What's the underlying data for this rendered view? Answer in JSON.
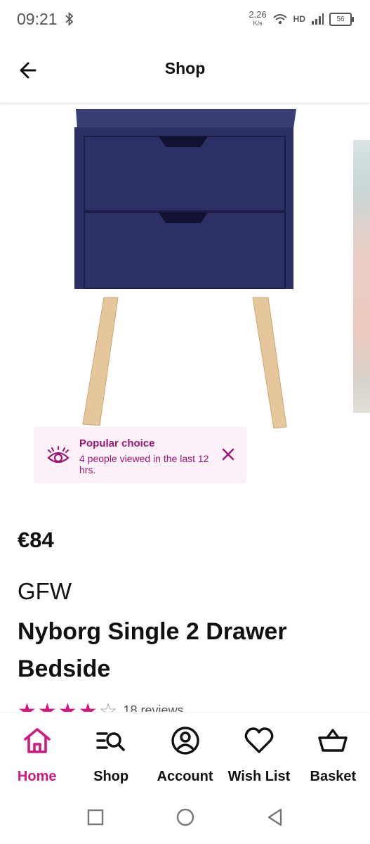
{
  "status_bar": {
    "time": "09:21",
    "net_speed": "2.26",
    "net_unit": "K/s",
    "hd": "HD",
    "battery": "56"
  },
  "header": {
    "title": "Shop"
  },
  "product": {
    "image_alt": "Navy two drawer bedside table on wooden legs",
    "popular": {
      "title": "Popular choice",
      "text": "4 people viewed in the last 12 hrs."
    },
    "price": "€84",
    "brand": "GFW",
    "title": "Nyborg Single 2 Drawer Bedside",
    "rating": 4.5,
    "review_count": "18 reviews"
  },
  "bottom_nav": {
    "items": [
      {
        "label": "Home",
        "icon": "home-icon",
        "active": true
      },
      {
        "label": "Shop",
        "icon": "shop-search-icon",
        "active": false
      },
      {
        "label": "Account",
        "icon": "account-icon",
        "active": false
      },
      {
        "label": "Wish List",
        "icon": "heart-icon",
        "active": false
      },
      {
        "label": "Basket",
        "icon": "basket-icon",
        "active": false
      }
    ]
  },
  "colors": {
    "accent": "#d0187f",
    "toast_bg": "#fcf1f8",
    "toast_text": "#9c1671",
    "furniture": "#2b2f63",
    "legs": "#e6c79b"
  }
}
